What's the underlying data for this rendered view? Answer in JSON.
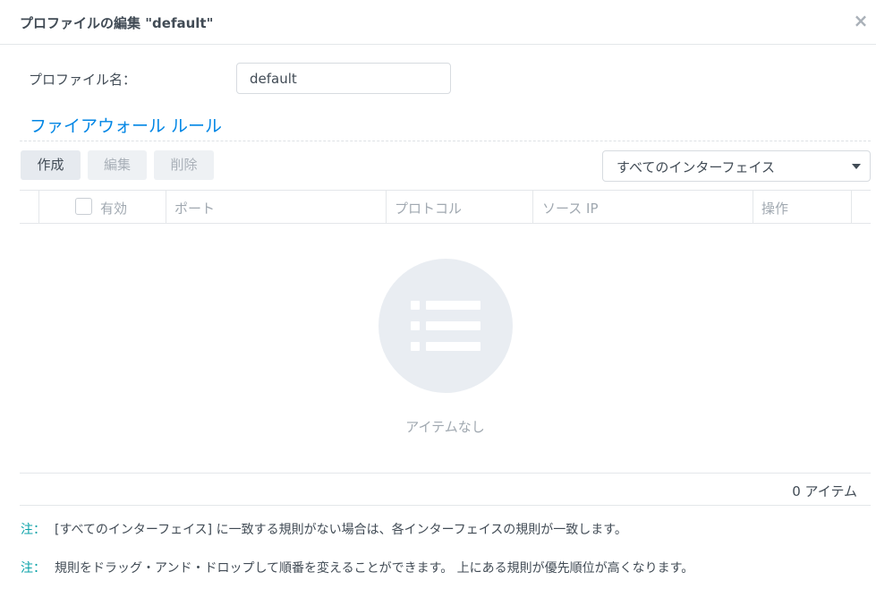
{
  "dialog": {
    "title": "プロファイルの編集 \"default\"",
    "close_symbol": "×"
  },
  "profile": {
    "name_label": "プロファイル名：",
    "name_value": "default"
  },
  "rules": {
    "section_title": "ファイアウォール ルール",
    "toolbar": {
      "create_label": "作成",
      "edit_label": "編集",
      "delete_label": "削除"
    },
    "interface_select": {
      "value": "すべてのインターフェイス"
    },
    "columns": [
      {
        "label": "有効"
      },
      {
        "label": "ポート"
      },
      {
        "label": "プロトコル"
      },
      {
        "label": "ソース IP"
      },
      {
        "label": "操作"
      }
    ],
    "empty_text": "アイテムなし",
    "item_count": "0 アイテム"
  },
  "notes": [
    {
      "label": "注：",
      "text": "[すべてのインターフェイス] に一致する規則がない場合は、各インターフェイスの規則が一致します。"
    },
    {
      "label": "注：",
      "text": "規則をドラッグ・アンド・ドロップして順番を変えることができます。 上にある規則が優先順位が高くなります。"
    }
  ],
  "colors": {
    "accent": "#0086e5",
    "note_label": "#0aa2a8",
    "button_bg": "#e6eaef"
  }
}
